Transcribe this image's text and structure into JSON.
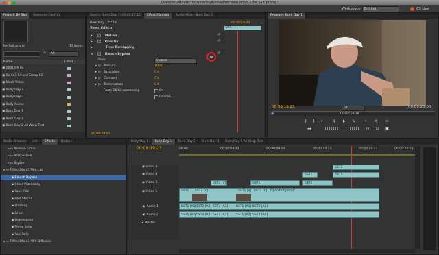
{
  "window": {
    "title": "/Users/ericM8Pro/Documents/Adobe/Premiere Pro/5.5/Be Salt.prproj *"
  },
  "workspace": {
    "label": "Workspace:",
    "value": "Editing",
    "cs_live": "CS Live"
  },
  "project": {
    "tabs": [
      "Project: Be Salt",
      "Resource Central"
    ],
    "filename": "Be Salt.prproj",
    "item_count": "13 Items",
    "in_label": "In:",
    "in_value": "All",
    "col_name": "Name",
    "col_label": "Label",
    "items": [
      {
        "name": "00014.MTS",
        "color": "#9bbcd8"
      },
      {
        "name": "Be Salt Linked Comp 01",
        "color": "#c9a6c9"
      },
      {
        "name": "Black Video",
        "color": "#c9a6c9"
      },
      {
        "name": "Bully Day 1",
        "color": "#a6d0c9"
      },
      {
        "name": "Bully Day 2",
        "color": "#a6d0c9"
      },
      {
        "name": "Bully Scene",
        "color": "#d6b25c"
      },
      {
        "name": "Burn Day 1",
        "color": "#a6d0c9"
      },
      {
        "name": "Burn Day 2",
        "color": "#a6d0c9"
      },
      {
        "name": "Burn Day 2 All Warp Test",
        "color": "#a6d0c9"
      }
    ]
  },
  "source": {
    "tabs": [
      "Source: Burn Day 1: 00:00:17:15",
      "Effect Controls",
      "Audio Mixer: Burn Day 1"
    ],
    "sequence": "Burn Day 1 * 5T2",
    "timecode_start": "00:00:19:23",
    "clip_label": "5T2",
    "section": "Video Effects",
    "effects": [
      {
        "name": "Motion",
        "has_fx": true
      },
      {
        "name": "Opacity",
        "has_fx": true
      },
      {
        "name": "Time Remapping",
        "has_fx": false
      },
      {
        "name": "Bleach Bypass",
        "has_fx": true
      }
    ],
    "params": [
      {
        "name": "View",
        "value": "Output"
      },
      {
        "name": "Amount",
        "value": "100.0"
      },
      {
        "name": "Saturation",
        "value": "0.0"
      },
      {
        "name": "Contrast",
        "value": "0.0"
      },
      {
        "name": "Temperature",
        "value": "0.0"
      }
    ],
    "force_label": "Force 16-bit processing",
    "force_value": "On",
    "license_label": "License...",
    "current_time": "00:00:19:05"
  },
  "program": {
    "tab": "Program: Burn Day 1",
    "timecode": "00:00:19:23",
    "zoom": "Fit",
    "duration": "00:00:23:00",
    "ruler_time": "00:04:59:16"
  },
  "effects_panel": {
    "tabs": [
      "Media Browser",
      "Info",
      "Effects",
      "History"
    ],
    "items": [
      {
        "name": "Noise & Grain",
        "indent": 1,
        "type": "folder"
      },
      {
        "name": "Perspective",
        "indent": 1,
        "type": "folder"
      },
      {
        "name": "Stylize",
        "indent": 1,
        "type": "folder"
      },
      {
        "name": "Tiffen Dfx v3 Film Lab",
        "indent": 0,
        "type": "folder"
      },
      {
        "name": "Bleach Bypass",
        "indent": 2,
        "type": "effect",
        "selected": true
      },
      {
        "name": "Cross Processing",
        "indent": 2,
        "type": "effect"
      },
      {
        "name": "Faux Film",
        "indent": 2,
        "type": "effect"
      },
      {
        "name": "Film Stocks",
        "indent": 2,
        "type": "effect"
      },
      {
        "name": "Flashing",
        "indent": 2,
        "type": "effect"
      },
      {
        "name": "Grain",
        "indent": 2,
        "type": "effect"
      },
      {
        "name": "Overexpose",
        "indent": 2,
        "type": "effect"
      },
      {
        "name": "Three Strip",
        "indent": 2,
        "type": "effect"
      },
      {
        "name": "Two Strip",
        "indent": 2,
        "type": "effect"
      },
      {
        "name": "Tiffen Dfx v3 HFX Diffusion",
        "indent": 0,
        "type": "folder"
      }
    ]
  },
  "timeline": {
    "tabs": [
      "Bully Day 1",
      "Burn Day 1",
      "Burn Day 2",
      "Burn Day 3",
      "Burn Day 2 All Warp Test"
    ],
    "timecode": "00:00:19:23",
    "ruler": [
      "00:00",
      "00:00:04:23",
      "00:00:09:23",
      "00:00:14:23",
      "00:00:19:23",
      "00:00:24:23"
    ],
    "tracks": [
      {
        "name": "Video 4"
      },
      {
        "name": "Video 3"
      },
      {
        "name": "Video 2"
      },
      {
        "name": "Video 1"
      },
      {
        "name": "Audio 1"
      },
      {
        "name": "Audio 2"
      },
      {
        "name": "Master"
      }
    ],
    "clips": {
      "v4": [
        "5ST2"
      ],
      "v3": [
        "5ST1",
        "5ST2"
      ],
      "v2": [
        "5ST1 [V]",
        "5ST1",
        "5ST2"
      ],
      "v1": [
        "5ST1",
        "5ST2 [V]",
        "5ST1 [V]",
        "5ST2 [V]",
        "Opacity:Opacity"
      ],
      "a1": [
        "5ST1 [A1]",
        "5ST2 [A1]",
        "5ST1 [A1]",
        "5ST1 [A1]",
        "5ST2 [A1]"
      ],
      "a2": [
        "5ST1 [A2]",
        "5ST2 [A2]",
        "5ST1 [A2]",
        "5ST1 [A2]",
        "5ST2 [A2]"
      ]
    }
  },
  "colors": {
    "accent_orange": "#f0a000",
    "clip_teal": "#8fc5c4",
    "highlight_red": "#e02020",
    "selected_effect": "#3d6aa6"
  }
}
